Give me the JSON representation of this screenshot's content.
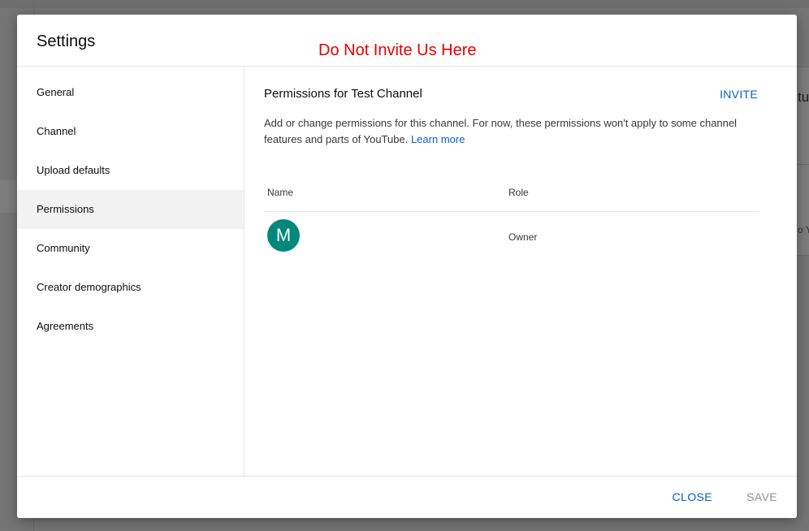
{
  "background": {
    "peek_top_text": "tu",
    "peek_mid_text": "o Yo"
  },
  "dialog": {
    "title": "Settings",
    "annotation": "Do Not Invite Us Here"
  },
  "sidebar": {
    "items": [
      {
        "label": "General",
        "selected": false
      },
      {
        "label": "Channel",
        "selected": false
      },
      {
        "label": "Upload defaults",
        "selected": false
      },
      {
        "label": "Permissions",
        "selected": true
      },
      {
        "label": "Community",
        "selected": false
      },
      {
        "label": "Creator demographics",
        "selected": false
      },
      {
        "label": "Agreements",
        "selected": false
      }
    ]
  },
  "permissions": {
    "title": "Permissions for Test Channel",
    "invite_label": "INVITE",
    "description": "Add or change permissions for this channel. For now, these permissions won't apply to some channel features and parts of YouTube.",
    "learn_more": "Learn more",
    "columns": {
      "name": "Name",
      "role": "Role"
    },
    "rows": [
      {
        "avatar_letter": "M",
        "avatar_color": "#00897b",
        "role": "Owner"
      }
    ]
  },
  "footer": {
    "close_label": "CLOSE",
    "save_label": "SAVE"
  },
  "colors": {
    "accent": "#065fd4",
    "annotation": "#e60000",
    "disabled": "#909090"
  }
}
